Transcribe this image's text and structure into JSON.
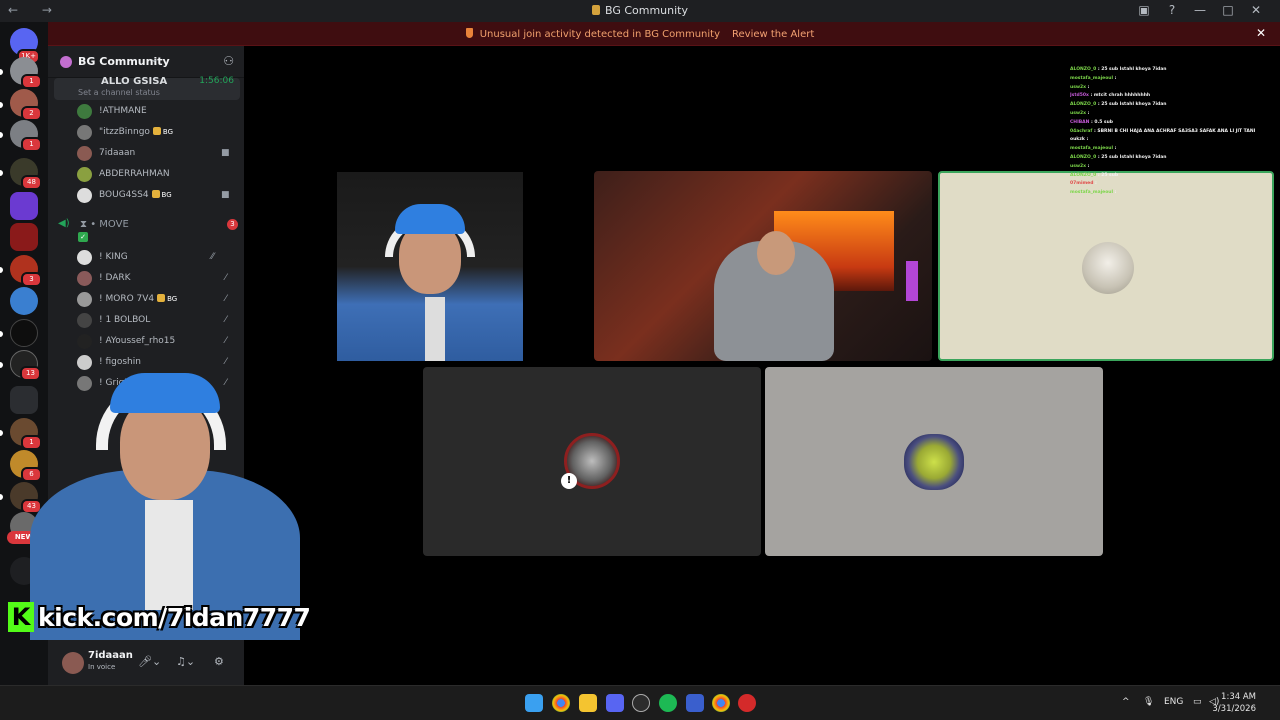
{
  "window": {
    "title": "BG Community",
    "nav_arrows": "← →",
    "controls": [
      "▣",
      "?",
      "—",
      "□",
      "✕"
    ]
  },
  "alert": {
    "message": "Unusual join activity detected in BG Community",
    "action": "Review the Alert",
    "close": "✕"
  },
  "server_rail": {
    "home_badge": "1K+",
    "new_label": "NEW",
    "badges": [
      "1",
      "2",
      "1",
      "48",
      "3",
      "13",
      "1",
      "6",
      "43"
    ]
  },
  "sidebar": {
    "server_name": "BG Community",
    "top_voice": {
      "name": "ALLO GSISA",
      "timer": "1:56:06",
      "status_placeholder": "Set a channel status"
    },
    "members_top": [
      {
        "name": "!ATHMANE",
        "tag": ""
      },
      {
        "name": "\"itzzBinngo",
        "tag": "BG"
      },
      {
        "name": "7idaaan",
        "tag": ""
      },
      {
        "name": "ABDERRAHMAN",
        "tag": ""
      },
      {
        "name": "BOUG4SS4",
        "tag": "BG"
      }
    ],
    "move_channel": {
      "name": "MOVE",
      "count": "3"
    },
    "members_move": [
      {
        "name": "! KING",
        "tag": ""
      },
      {
        "name": "! DARK",
        "tag": ""
      },
      {
        "name": "! MORO 7V4",
        "tag": "BG"
      },
      {
        "name": "! 1 BOLBOL",
        "tag": ""
      },
      {
        "name": "! AYoussef_rho15",
        "tag": ""
      },
      {
        "name": "! figoshin",
        "tag": ""
      },
      {
        "name": "! Grig7a",
        "tag": ""
      }
    ],
    "user_panel": {
      "username": "7idaaan",
      "status": "In voice"
    }
  },
  "stream_overlay": {
    "kick_logo": "K",
    "kick_url": "kick.com/7idan7777"
  },
  "chat_overlay": {
    "messages": [
      {
        "user": "ALONZO_0",
        "text": ": 25 sub Istahl khoya 7idan",
        "color": "#7cd64a"
      },
      {
        "user": "mostafa_majeoul",
        "text": ":",
        "color": "#7cd64a"
      },
      {
        "user": "usw2x",
        "text": ":",
        "color": "#7cd64a"
      },
      {
        "user": "Jstd50x",
        "text": ": mtcit chrah hhhhhhhh",
        "color": "#c55ad8"
      },
      {
        "user": "ALONZO_0",
        "text": ": 25 sub Istahl khoya 7idan",
        "color": "#7cd64a"
      },
      {
        "user": "usw2x",
        "text": ":",
        "color": "#7cd64a"
      },
      {
        "user": "CHIBAN",
        "text": ": 0.5 sub",
        "color": "#c55ad8"
      },
      {
        "user": "04achraf",
        "text": ": SBRNI B CHI HAJA ANA ACHRAF SA3SA3 SAFAK ANA LI JIT TANI",
        "color": "#7cd64a"
      },
      {
        "user": "oukzk",
        "text": ":",
        "color": "#f2f2f2"
      },
      {
        "user": "mostafa_majeoul",
        "text": ":",
        "color": "#7cd64a"
      },
      {
        "user": "ALONZO_0",
        "text": ": 25 sub Istahl khoya 7idan",
        "color": "#7cd64a"
      },
      {
        "user": "usw2x",
        "text": ":",
        "color": "#7cd64a"
      },
      {
        "user": "ALONZO_0",
        "text": ": 25 sub",
        "color": "#7cd64a"
      },
      {
        "user": "07mimed",
        "text": ":",
        "color": "#e04a4a"
      },
      {
        "user": "mostafa_majeoul",
        "text": ":",
        "color": "#7cd64a"
      }
    ]
  },
  "taskbar": {
    "tray": {
      "up_arrow": "^",
      "lang": "ENG"
    },
    "time": "1:34 AM",
    "date": "3/31/2026",
    "discord_badge": "10"
  },
  "colors": {
    "alert_bg": "#3f0d10",
    "alert_text": "#f0a06d",
    "speaking_border": "#3ba55c",
    "badge_red": "#da373c",
    "kick_green": "#53fc18"
  }
}
